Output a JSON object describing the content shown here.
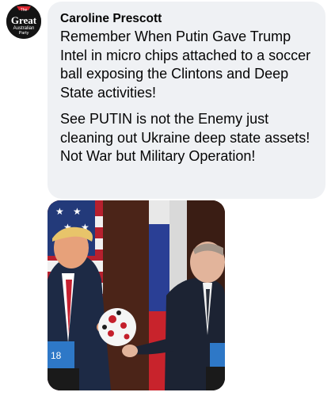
{
  "avatar": {
    "icon": "great-australian-party-logo-icon",
    "logo_text": [
      "The",
      "Great",
      "Australian",
      "Party"
    ]
  },
  "comment": {
    "author": "Caroline Prescott",
    "paragraphs": [
      "Remember When Putin Gave Trump Intel in micro chips attached to a soccer ball exposing the Clintons and Deep State activities!",
      "See PUTIN is not the Enemy just cleaning out Ukraine deep state assets! Not War but Military Operation!"
    ]
  },
  "photo": {
    "icon": "attached-photo",
    "podium_text": "18"
  },
  "colors": {
    "bubble_bg": "#eff1f4",
    "text": "#050505",
    "logo_red": "#d9232e"
  }
}
